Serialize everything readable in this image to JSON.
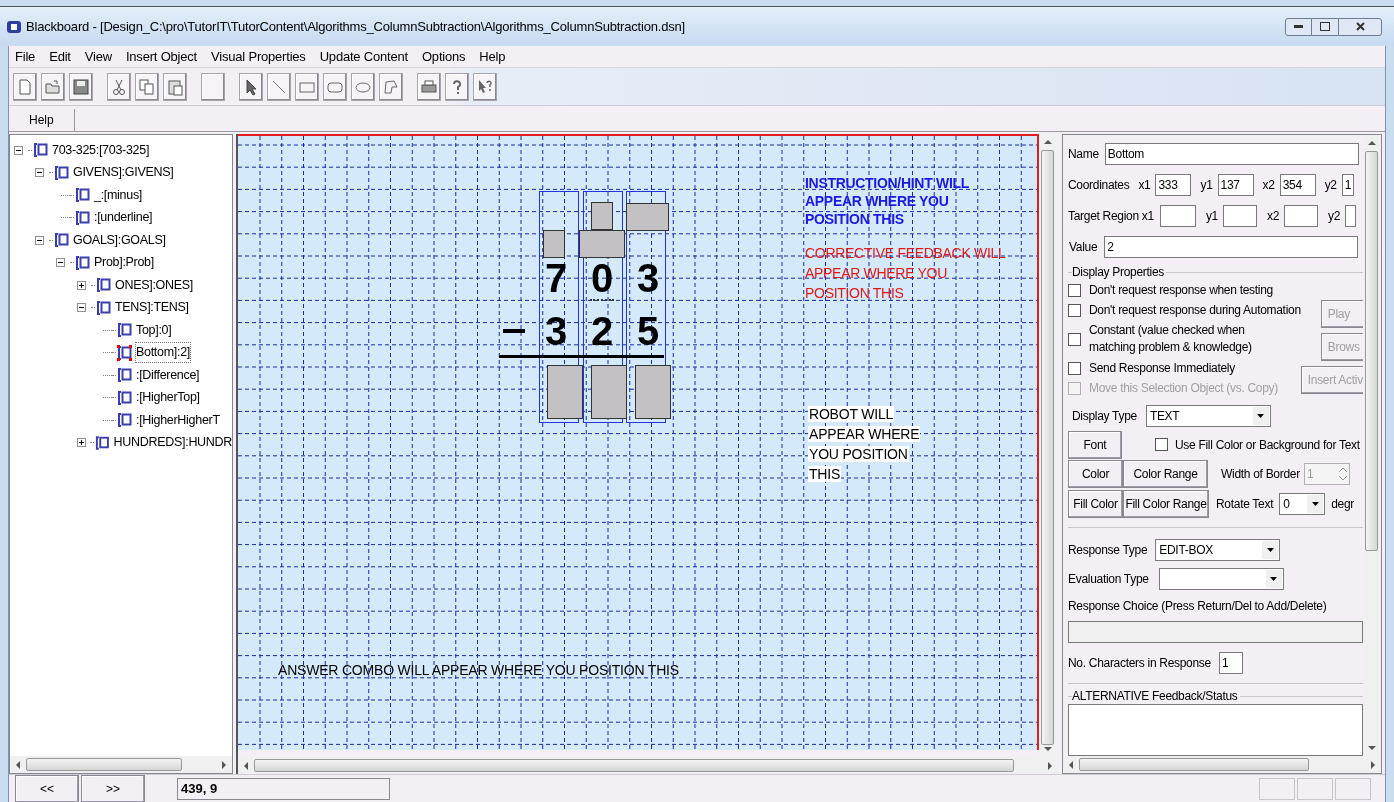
{
  "window": {
    "title": "Blackboard - [Design_C:\\pro\\TutorIT\\TutorContent\\Algorithms_ColumnSubtraction\\Algorithms_ColumnSubtraction.dsn]"
  },
  "menu": [
    "File",
    "Edit",
    "View",
    "Insert Object",
    "Visual Properties",
    "Update Content",
    "Options",
    "Help"
  ],
  "help_tab": "Help",
  "tree": [
    {
      "label": "703-325:[703-325]",
      "kind": "node",
      "expanded": true,
      "selected": false,
      "children": [
        {
          "label": "GIVENS]:GIVENS]",
          "kind": "node",
          "expanded": true,
          "selected": false,
          "children": [
            {
              "label": "_:[minus]",
              "kind": "leaf",
              "selected": false
            },
            {
              "label": ":[underline]",
              "kind": "leaf",
              "selected": false
            }
          ]
        },
        {
          "label": "GOALS]:GOALS]",
          "kind": "node",
          "expanded": true,
          "selected": false,
          "children": [
            {
              "label": "Prob]:Prob]",
              "kind": "node",
              "expanded": true,
              "selected": false,
              "children": [
                {
                  "label": "ONES]:ONES]",
                  "kind": "node",
                  "expanded": false,
                  "selected": false
                },
                {
                  "label": "TENS]:TENS]",
                  "kind": "node",
                  "expanded": true,
                  "selected": false,
                  "children": [
                    {
                      "label": "Top]:0]",
                      "kind": "leaf",
                      "selected": false
                    },
                    {
                      "label": "Bottom]:2]",
                      "kind": "leaf",
                      "selected": true
                    },
                    {
                      "label": ":[Difference]",
                      "kind": "leaf",
                      "selected": false
                    },
                    {
                      "label": ":[HigherTop]",
                      "kind": "leaf",
                      "selected": false
                    },
                    {
                      "label": ":[HigherHigherT",
                      "kind": "leaf",
                      "selected": false
                    }
                  ]
                },
                {
                  "label": "HUNDREDS]:HUNDR",
                  "kind": "node",
                  "expanded": false,
                  "selected": false
                }
              ]
            }
          ]
        }
      ]
    }
  ],
  "canvas": {
    "top_digits": [
      "7",
      "0",
      "3"
    ],
    "bottom_digits": [
      "3",
      "2",
      "5"
    ],
    "instruction": "INSTRUCTION/HINT WILL APPEAR WHERE YOU POSITION THIS",
    "feedback": "CORRECTIVE FEEDBACK WILL APPEAR WHERE YOU POSITION THIS",
    "robot": "ROBOT WILL APPEAR WHERE YOU POSITION THIS",
    "answer_combo": "ANSWER COMBO WILL APPEAR WHERE YOU POSITION THIS"
  },
  "properties": {
    "name_label": "Name",
    "name": "Bottom",
    "coordinates_label": "Coordinates",
    "coordinates": [
      {
        "label": "x1",
        "value": "333"
      },
      {
        "label": "y1",
        "value": "137"
      },
      {
        "label": "x2",
        "value": "354"
      },
      {
        "label": "y2",
        "value": "1"
      }
    ],
    "target_label": "Target Region x1",
    "target": [
      {
        "label": "y1"
      },
      {
        "label": "x2"
      },
      {
        "label": "y2"
      }
    ],
    "value_label": "Value",
    "value": "2",
    "display_group": "Display Properties",
    "checkboxes": [
      {
        "label": "Don't request response when testing",
        "checked": false,
        "disabled": false
      },
      {
        "label": "Don't request response during Automation",
        "checked": false,
        "disabled": false
      },
      {
        "label": "Constant (value checked when matching problem & knowledge)",
        "checked": false,
        "disabled": false
      },
      {
        "label": "Send Response Immediately",
        "checked": false,
        "disabled": false
      },
      {
        "label": "Move this Selection Object (vs. Copy)",
        "checked": false,
        "disabled": true
      }
    ],
    "side_buttons": [
      {
        "label": "Play",
        "disabled": true
      },
      {
        "label": "Brows",
        "disabled": true
      },
      {
        "label": "Insert Activ",
        "disabled": true
      }
    ],
    "display_type_label": "Display Type",
    "display_type": "TEXT",
    "font_button": "Font",
    "fill_checkbox": {
      "label": "Use Fill Color or Background for Text",
      "checked": false
    },
    "color_button": "Color",
    "color_range_button": "Color Range",
    "border_label": "Width of Border",
    "border_value": "1",
    "fill_color_button": "Fill Color",
    "fill_color_range_button": "Fill Color Range",
    "rotate_label": "Rotate Text",
    "rotate_value": "0",
    "rotate_unit": "degr",
    "response_type_label": "Response Type",
    "response_type": "EDIT-BOX",
    "evaluation_type_label": "Evaluation Type",
    "response_choice_label": "Response Choice  (Press Return/Del to Add/Delete)",
    "chars_label": "No. Characters in Response",
    "chars_value": "1",
    "alt_group": "ALTERNATIVE Feedback/Status"
  },
  "status_bar": {
    "prev": "<<",
    "next": ">>",
    "position": "439, 9"
  }
}
